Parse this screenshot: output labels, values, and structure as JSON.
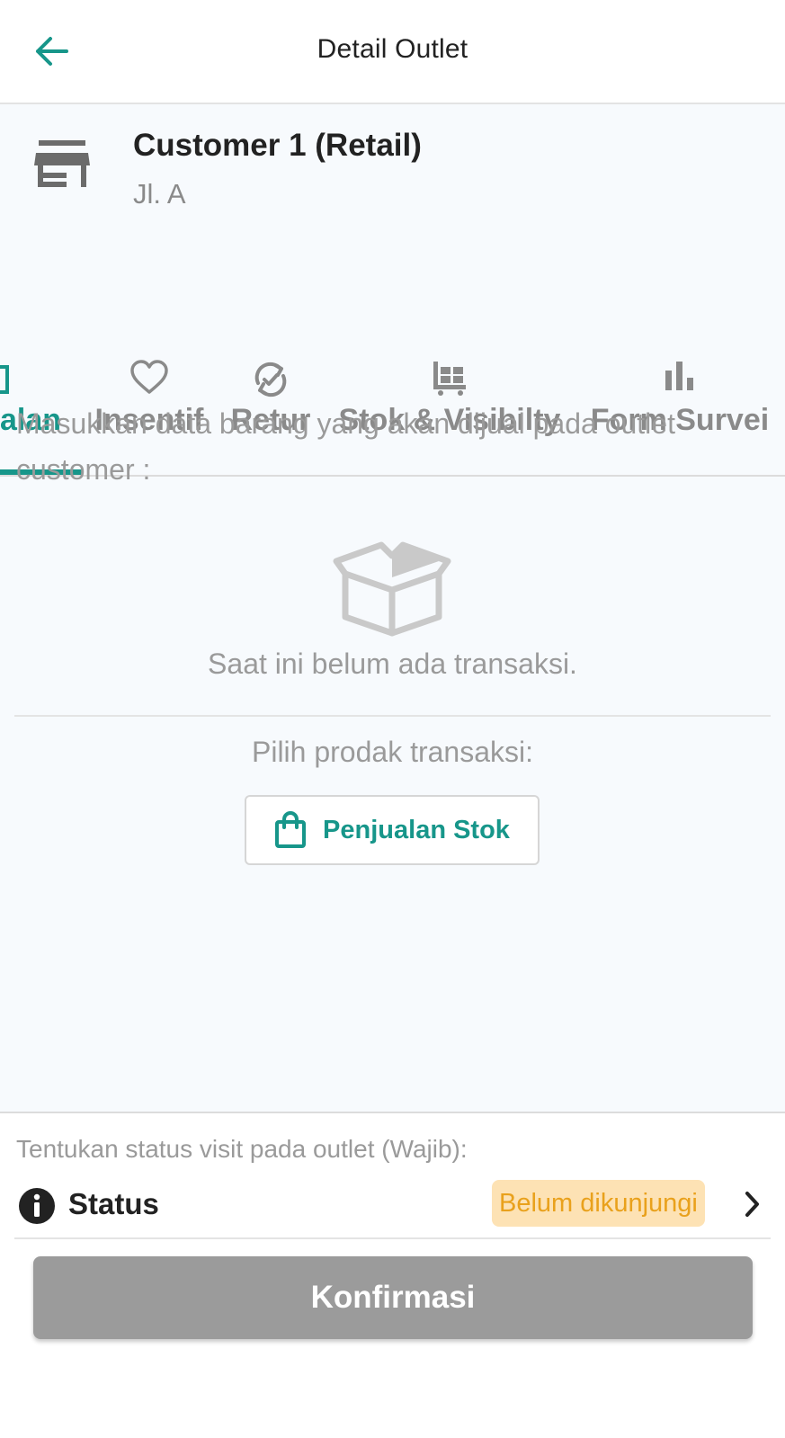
{
  "header": {
    "title": "Detail Outlet",
    "back_icon": "arrow-left-icon"
  },
  "outlet": {
    "name": "Customer 1 (Retail)",
    "address": "Jl. A",
    "icon": "store-icon"
  },
  "tabs": [
    {
      "label": "alan",
      "icon": "shopping-bag-icon",
      "active": true
    },
    {
      "label": "Insentif",
      "icon": "heart-icon",
      "active": false
    },
    {
      "label": "Retur",
      "icon": "return-icon",
      "active": false
    },
    {
      "label": "Stok & Visibilty",
      "icon": "cart-icon",
      "active": false
    },
    {
      "label": "Form Survei",
      "icon": "bar-chart-icon",
      "active": false
    }
  ],
  "main": {
    "intro": "Masukkan data barang yang akan dijual pada outlet customer :",
    "empty_icon": "open-box-icon",
    "empty_text": "Saat ini belum ada transaksi.",
    "choose_text": "Pilih prodak transaksi:",
    "sale_button": {
      "label": "Penjualan Stok",
      "icon": "shopping-bag-icon"
    }
  },
  "visit": {
    "prompt": "Tentukan status visit pada outlet (Wajib):",
    "status_label": "Status",
    "status_value": "Belum dikunjungi",
    "info_icon": "info-icon",
    "chevron_icon": "chevron-right-icon"
  },
  "confirm_button": {
    "label": "Konfirmasi"
  },
  "colors": {
    "primary": "#17968a",
    "muted_text": "#9a9a9a",
    "content_bg": "#f7fafd",
    "status_badge_bg": "#fde2b4",
    "status_badge_text": "#e9a11c",
    "disabled_button": "#9b9b9b"
  }
}
